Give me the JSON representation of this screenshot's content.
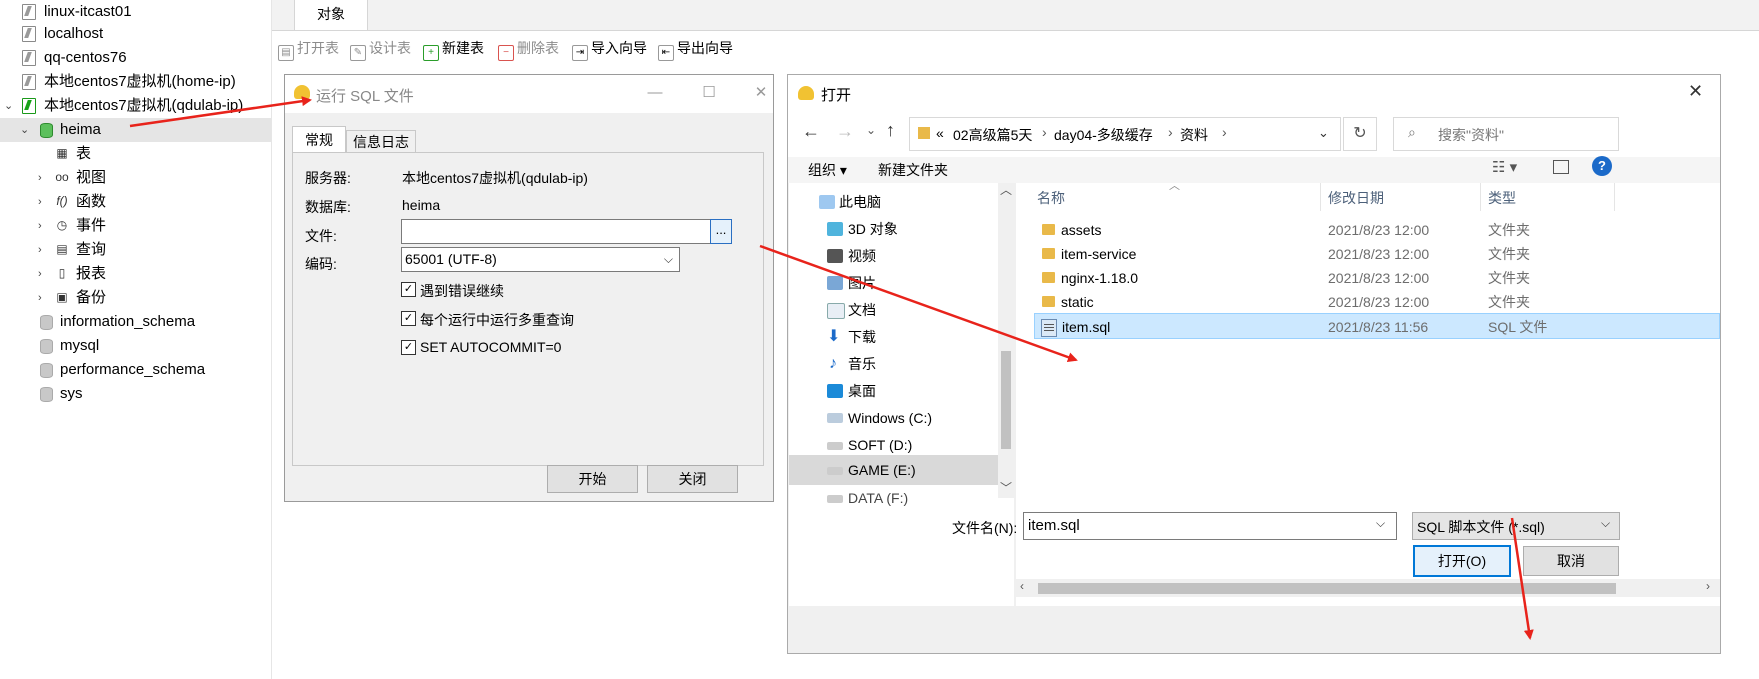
{
  "tree": {
    "connections": [
      "linux-itcast01",
      "localhost",
      "qq-centos76",
      "本地centos7虚拟机(home-ip)",
      "本地centos7虚拟机(qdulab-ip)"
    ],
    "selected_db": "heima",
    "db_children": [
      "表",
      "视图",
      "函数",
      "事件",
      "查询",
      "报表",
      "备份"
    ],
    "other_dbs": [
      "information_schema",
      "mysql",
      "performance_schema",
      "sys"
    ]
  },
  "tabs": {
    "object": "对象"
  },
  "toolbar": {
    "open_table": "打开表",
    "design_table": "设计表",
    "new_table": "新建表",
    "delete_table": "删除表",
    "import_wizard": "导入向导",
    "export_wizard": "导出向导"
  },
  "runsql": {
    "title": "运行 SQL 文件",
    "tab_general": "常规",
    "tab_log": "信息日志",
    "server_label": "服务器:",
    "server_value": "本地centos7虚拟机(qdulab-ip)",
    "db_label": "数据库:",
    "db_value": "heima",
    "file_label": "文件:",
    "file_value": "",
    "browse_label": "...",
    "encoding_label": "编码:",
    "encoding_value": "65001 (UTF-8)",
    "check1": "遇到错误继续",
    "check2": "每个运行中运行多重查询",
    "check3": "SET AUTOCOMMIT=0",
    "start": "开始",
    "close": "关闭"
  },
  "opendlg": {
    "title": "打开",
    "breadcrumb": [
      "«",
      "02高级篇5天",
      "day04-多级缓存",
      "资料"
    ],
    "search_placeholder": "搜索\"资料\"",
    "organize": "组织 ▾",
    "new_folder": "新建文件夹",
    "nav": [
      "此电脑",
      "3D 对象",
      "视频",
      "图片",
      "文档",
      "下载",
      "音乐",
      "桌面",
      "Windows (C:)",
      "SOFT (D:)",
      "GAME (E:)",
      "DATA (F:)"
    ],
    "columns": {
      "name": "名称",
      "date": "修改日期",
      "type": "类型"
    },
    "files": [
      {
        "name": "assets",
        "date": "2021/8/23 12:00",
        "type": "文件夹"
      },
      {
        "name": "item-service",
        "date": "2021/8/23 12:00",
        "type": "文件夹"
      },
      {
        "name": "nginx-1.18.0",
        "date": "2021/8/23 12:00",
        "type": "文件夹"
      },
      {
        "name": "static",
        "date": "2021/8/23 12:00",
        "type": "文件夹"
      },
      {
        "name": "item.sql",
        "date": "2021/8/23 11:56",
        "type": "SQL 文件"
      }
    ],
    "filename_label": "文件名(N):",
    "filename_value": "item.sql",
    "filter_value": "SQL 脚本文件 (*.sql)",
    "open_button": "打开(O)",
    "cancel_button": "取消"
  },
  "colors": {
    "selection": "#cce8ff",
    "selection_border": "#99d1ff",
    "arrow": "#e8231b",
    "tree_selected": "#e5e5e5"
  }
}
